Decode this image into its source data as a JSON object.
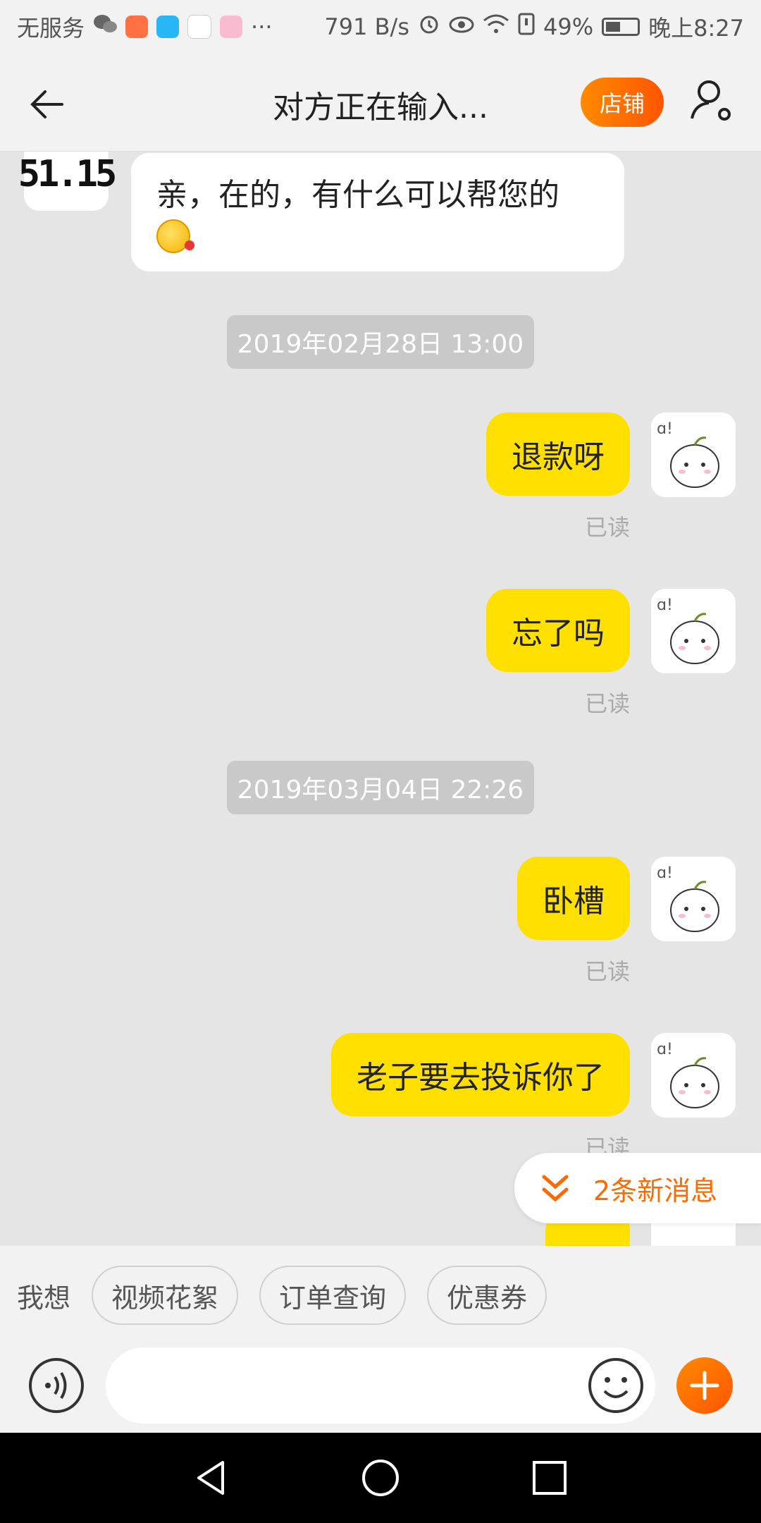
{
  "status_bar": {
    "carrier": "无服务",
    "more": "···",
    "speed": "791 B/s",
    "battery": "49%",
    "time": "晚上8:27",
    "icons": [
      "wechat-icon",
      "video-app-icon",
      "delivery-app-icon",
      "map-pin-app-icon",
      "photos-app-icon",
      "alarm-icon",
      "eye-icon",
      "wifi-icon",
      "sim-icon",
      "battery-icon"
    ]
  },
  "header": {
    "title": "对方正在输入...",
    "shop_button": "店铺",
    "accent": "#ff6a00"
  },
  "chat": {
    "shop_avatar_text": "51.15",
    "incoming": [
      {
        "text": "亲，在的，有什么可以帮您的",
        "emoji": "smile-emoji"
      }
    ],
    "timestamps": [
      "2019年02月28日 13:00",
      "2019年03月04日 22:26"
    ],
    "outgoing": [
      {
        "text": "退款呀",
        "status": "已读"
      },
      {
        "text": "忘了吗",
        "status": "已读"
      },
      {
        "text": "卧槽",
        "status": "已读"
      },
      {
        "text": "老子要去投诉你了",
        "status": "已读"
      }
    ],
    "bubble_color": "#ffe000",
    "new_messages": "2条新消息"
  },
  "quick_bar": {
    "label": "我想",
    "chips": [
      "视频花絮",
      "订单查询",
      "优惠券"
    ]
  },
  "input": {
    "placeholder": ""
  }
}
